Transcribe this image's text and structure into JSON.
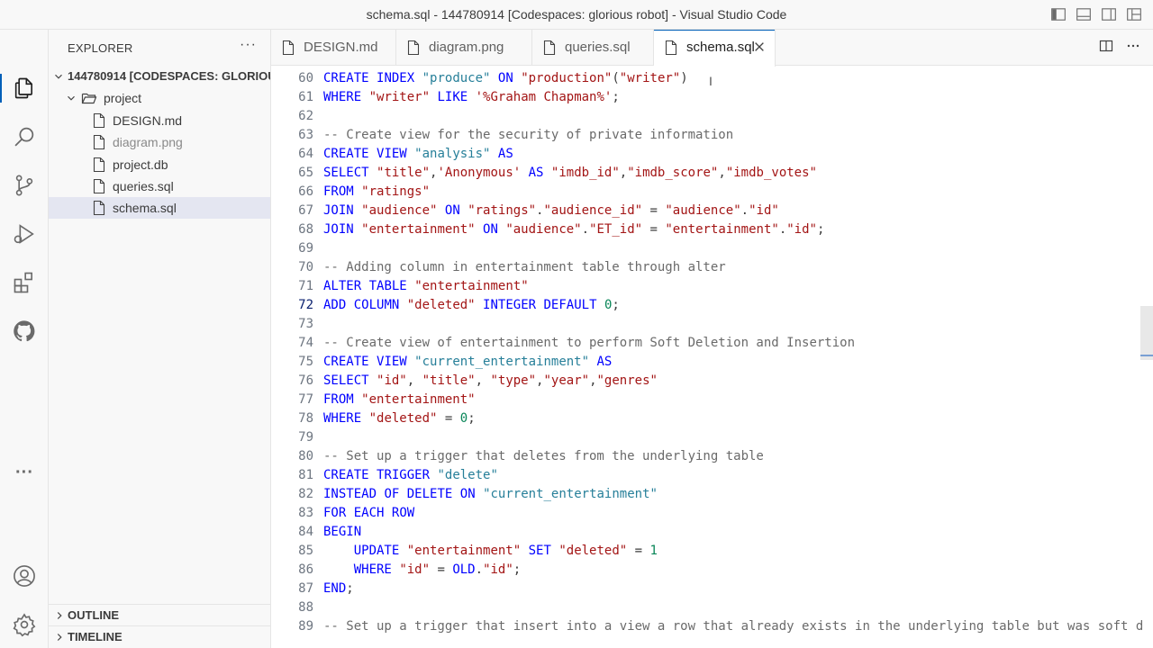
{
  "window": {
    "title": "schema.sql - 144780914 [Codespaces: glorious robot] - Visual Studio Code"
  },
  "activity_bar": {
    "items": [
      "explorer-icon",
      "search-icon",
      "source-control-icon",
      "run-debug-icon",
      "extensions-icon",
      "github-icon",
      "more-icon",
      "account-icon",
      "settings-gear-icon"
    ],
    "more_label": "···"
  },
  "sidebar": {
    "header": "EXPLORER",
    "more": "···",
    "root": "144780914 [CODESPACES: GLORIOU...",
    "folder": "project",
    "files": [
      "DESIGN.md",
      "diagram.png",
      "project.db",
      "queries.sql",
      "schema.sql"
    ],
    "selected_file": "schema.sql",
    "sections": [
      "OUTLINE",
      "TIMELINE"
    ]
  },
  "tabs": [
    {
      "label": "DESIGN.md"
    },
    {
      "label": "diagram.png"
    },
    {
      "label": "queries.sql"
    },
    {
      "label": "schema.sql",
      "active": true
    }
  ],
  "editor": {
    "current_line": 72,
    "lines": [
      {
        "n": "60",
        "t": "CREATE INDEX \"produce\" ON \"production\"(\"writer\")"
      },
      {
        "n": "61",
        "t": "WHERE \"writer\" LIKE '%Graham Chapman%';"
      },
      {
        "n": "62",
        "t": ""
      },
      {
        "n": "63",
        "t": "-- Create view for the security of private information"
      },
      {
        "n": "64",
        "t": "CREATE VIEW \"analysis\" AS"
      },
      {
        "n": "65",
        "t": "SELECT \"title\",'Anonymous' AS \"imdb_id\",\"imdb_score\",\"imdb_votes\""
      },
      {
        "n": "66",
        "t": "FROM \"ratings\""
      },
      {
        "n": "67",
        "t": "JOIN \"audience\" ON \"ratings\".\"audience_id\" = \"audience\".\"id\""
      },
      {
        "n": "68",
        "t": "JOIN \"entertainment\" ON \"audience\".\"ET_id\" = \"entertainment\".\"id\";"
      },
      {
        "n": "69",
        "t": ""
      },
      {
        "n": "70",
        "t": "-- Adding column in entertainment table through alter"
      },
      {
        "n": "71",
        "t": "ALTER TABLE \"entertainment\""
      },
      {
        "n": "72",
        "t": "ADD COLUMN \"deleted\" INTEGER DEFAULT 0;"
      },
      {
        "n": "73",
        "t": ""
      },
      {
        "n": "74",
        "t": "-- Create view of entertainment to perform Soft Deletion and Insertion"
      },
      {
        "n": "75",
        "t": "CREATE VIEW \"current_entertainment\" AS"
      },
      {
        "n": "76",
        "t": "SELECT \"id\", \"title\", \"type\",\"year\",\"genres\""
      },
      {
        "n": "77",
        "t": "FROM \"entertainment\""
      },
      {
        "n": "78",
        "t": "WHERE \"deleted\" = 0;"
      },
      {
        "n": "79",
        "t": ""
      },
      {
        "n": "80",
        "t": "-- Set up a trigger that deletes from the underlying table"
      },
      {
        "n": "81",
        "t": "CREATE TRIGGER \"delete\""
      },
      {
        "n": "82",
        "t": "INSTEAD OF DELETE ON \"current_entertainment\""
      },
      {
        "n": "83",
        "t": "FOR EACH ROW"
      },
      {
        "n": "84",
        "t": "BEGIN"
      },
      {
        "n": "85",
        "t": "    UPDATE \"entertainment\" SET \"deleted\" = 1"
      },
      {
        "n": "86",
        "t": "    WHERE \"id\" = OLD.\"id\";"
      },
      {
        "n": "87",
        "t": "END;"
      },
      {
        "n": "88",
        "t": ""
      },
      {
        "n": "89",
        "t": "-- Set up a trigger that insert into a view a row that already exists in the underlying table but was soft d"
      }
    ]
  },
  "colors": {
    "keyword": "#0000ff",
    "string": "#a31515",
    "number": "#098658",
    "comment": "#6a6a6a",
    "view_name": "#267f99",
    "accent": "#005fb8"
  }
}
